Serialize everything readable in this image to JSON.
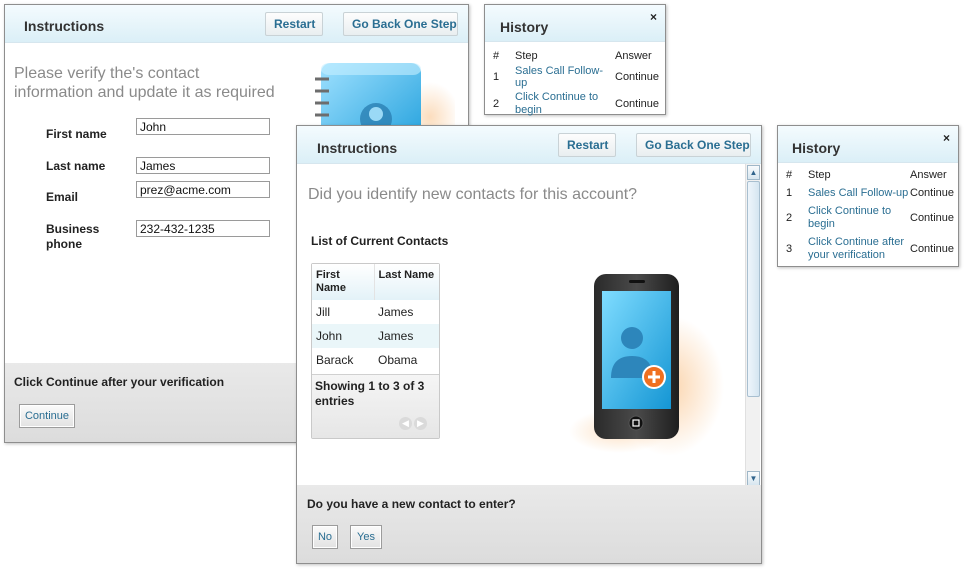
{
  "panel1": {
    "title": "Instructions",
    "restart_label": "Restart",
    "back_label": "Go Back One Step",
    "prompt": "Please verify the's contact information and update it as required",
    "fields": [
      {
        "label": "First name",
        "value": "John"
      },
      {
        "label": "Last name",
        "value": "James"
      },
      {
        "label": "Email",
        "value": "prez@acme.com"
      },
      {
        "label": "Business phone",
        "value": "232-432-1235"
      }
    ],
    "footer_question": "Click Continue after your verification",
    "continue_label": "Continue"
  },
  "history1": {
    "title": "History",
    "close": "×",
    "headers": {
      "num": "#",
      "step": "Step",
      "answer": "Answer"
    },
    "rows": [
      {
        "num": "1",
        "step": "Sales Call Follow-up",
        "answer": "Continue"
      },
      {
        "num": "2",
        "step": "Click Continue to begin",
        "answer": "Continue"
      }
    ]
  },
  "panel2": {
    "title": "Instructions",
    "restart_label": "Restart",
    "back_label": "Go Back One Step",
    "prompt": "Did you identify new contacts for this account?",
    "contacts_heading": "List of Current Contacts",
    "table_headers": {
      "first": "First Name",
      "last": "Last Name"
    },
    "contacts": [
      {
        "first": "Jill",
        "last": "James"
      },
      {
        "first": "John",
        "last": "James"
      },
      {
        "first": "Barack",
        "last": "Obama"
      }
    ],
    "showing": "Showing 1 to 3 of 3 entries",
    "footer_question": "Do you have a new contact to enter?",
    "no_label": "No",
    "yes_label": "Yes"
  },
  "history2": {
    "title": "History",
    "close": "×",
    "headers": {
      "num": "#",
      "step": "Step",
      "answer": "Answer"
    },
    "rows": [
      {
        "num": "1",
        "step": "Sales Call Follow-up",
        "answer": "Continue"
      },
      {
        "num": "2",
        "step": "Click Continue to begin",
        "answer": "Continue"
      },
      {
        "num": "3",
        "step": "Click Continue after your verification",
        "answer": "Continue"
      }
    ]
  },
  "icons": {
    "address_book": "address-book-icon",
    "phone_add_contact": "phone-add-contact-icon",
    "close": "close-icon"
  },
  "colors": {
    "header_bg": "#dbeff7",
    "link": "#2a6e92",
    "accent_orange": "#f07020"
  }
}
